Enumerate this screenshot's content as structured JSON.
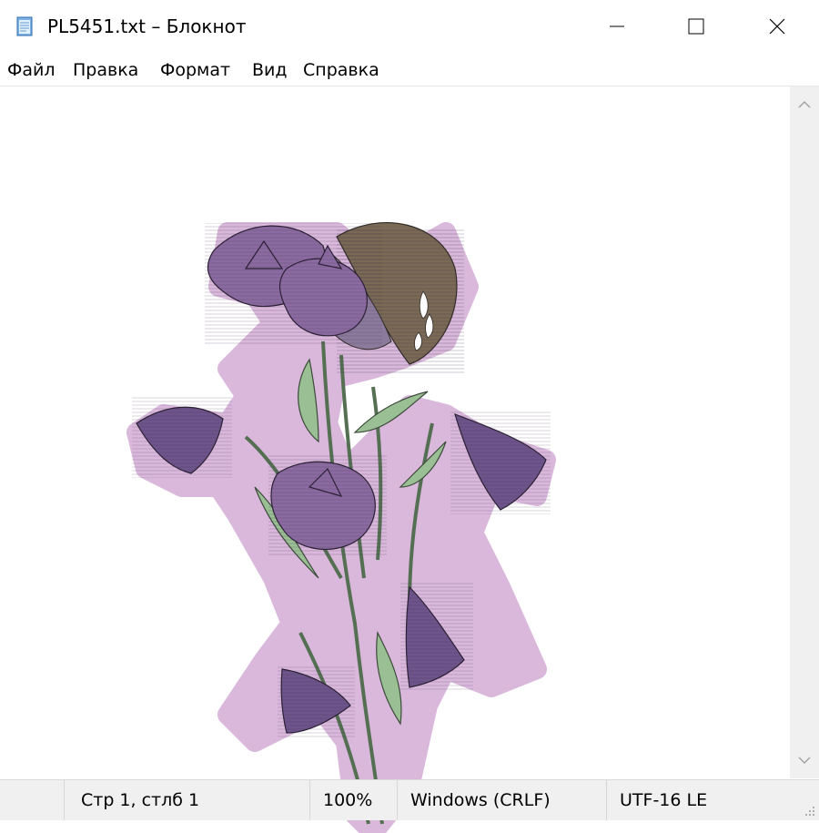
{
  "window": {
    "title": "PL5451.txt – Блокнот",
    "icons": {
      "app": "notepad-icon",
      "minimize": "minimize-icon",
      "maximize": "maximize-icon",
      "close": "close-icon"
    }
  },
  "menu": {
    "items": [
      "Файл",
      "Правка",
      "Формат",
      "Вид",
      "Справка"
    ]
  },
  "status": {
    "position": "Стр 1, стлб 1",
    "zoom": "100%",
    "line_ending": "Windows (CRLF)",
    "encoding": "UTF-16 LE"
  },
  "colors": {
    "halo": "#d9b8dc",
    "petal": "#8a6aa0",
    "petal_dark": "#5b4573",
    "stem": "#7a9a76",
    "leaf": "#9bbf94",
    "wing": "#7a6a55",
    "spot": "#ffffff"
  }
}
